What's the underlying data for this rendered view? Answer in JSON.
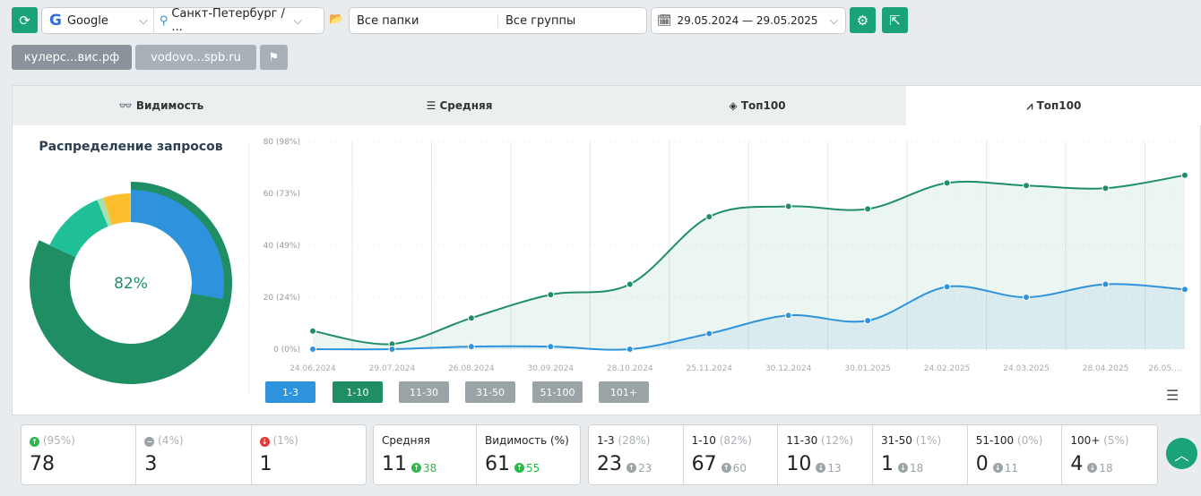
{
  "toolbar": {
    "search_engine": "Google",
    "region": "Санкт-Петербург / ...",
    "folders": "Все папки",
    "groups": "Все группы",
    "date_range": "29.05.2024 — 29.05.2025"
  },
  "domains": [
    "кулерс...вис.рф",
    "vodovo...spb.ru"
  ],
  "tabs": [
    "Видимость",
    "Средняя",
    "Топ100",
    "Топ100"
  ],
  "donut": {
    "title": "Распределение запросов",
    "center": "82%"
  },
  "chart_data": {
    "type": "line",
    "x": [
      "24.06.2024",
      "29.07.2024",
      "26.08.2024",
      "30.09.2024",
      "28.10.2024",
      "25.11.2024",
      "30.12.2024",
      "30.01.2025",
      "24.02.2025",
      "24.03.2025",
      "28.04.2025",
      "26.05...."
    ],
    "yticks": [
      "0 (0%)",
      "20 (24%)",
      "40 (49%)",
      "60 (73%)",
      "80 (98%)"
    ],
    "ylim": [
      0,
      80
    ],
    "series": [
      {
        "name": "1-10",
        "color": "#1f8f63",
        "values": [
          7,
          2,
          12,
          21,
          25,
          51,
          55,
          54,
          64,
          63,
          62,
          67
        ]
      },
      {
        "name": "1-3",
        "color": "#2e93dc",
        "values": [
          0,
          0,
          1,
          1,
          0,
          6,
          13,
          11,
          24,
          20,
          25,
          23
        ]
      }
    ],
    "legend": [
      "1-3",
      "1-10",
      "11-30",
      "31-50",
      "51-100",
      "101+"
    ]
  },
  "stats": {
    "up": {
      "pct": "(95%)",
      "value": "78"
    },
    "same": {
      "pct": "(4%)",
      "value": "3"
    },
    "down": {
      "pct": "(1%)",
      "value": "1"
    },
    "avg": {
      "label": "Средняя",
      "value": "11",
      "delta": "38"
    },
    "vis": {
      "label": "Видимость (%)",
      "value": "61",
      "delta": "55"
    }
  },
  "ranges": [
    {
      "label": "1-3",
      "pct": "(28%)",
      "value": "23",
      "delta": "23",
      "dir": "up"
    },
    {
      "label": "1-10",
      "pct": "(82%)",
      "value": "67",
      "delta": "60",
      "dir": "up"
    },
    {
      "label": "11-30",
      "pct": "(12%)",
      "value": "10",
      "delta": "13",
      "dir": "down"
    },
    {
      "label": "31-50",
      "pct": "(1%)",
      "value": "1",
      "delta": "18",
      "dir": "down"
    },
    {
      "label": "51-100",
      "pct": "(0%)",
      "value": "0",
      "delta": "11",
      "dir": "down"
    },
    {
      "label": "100+",
      "pct": "(5%)",
      "value": "4",
      "delta": "18",
      "dir": "down"
    }
  ]
}
